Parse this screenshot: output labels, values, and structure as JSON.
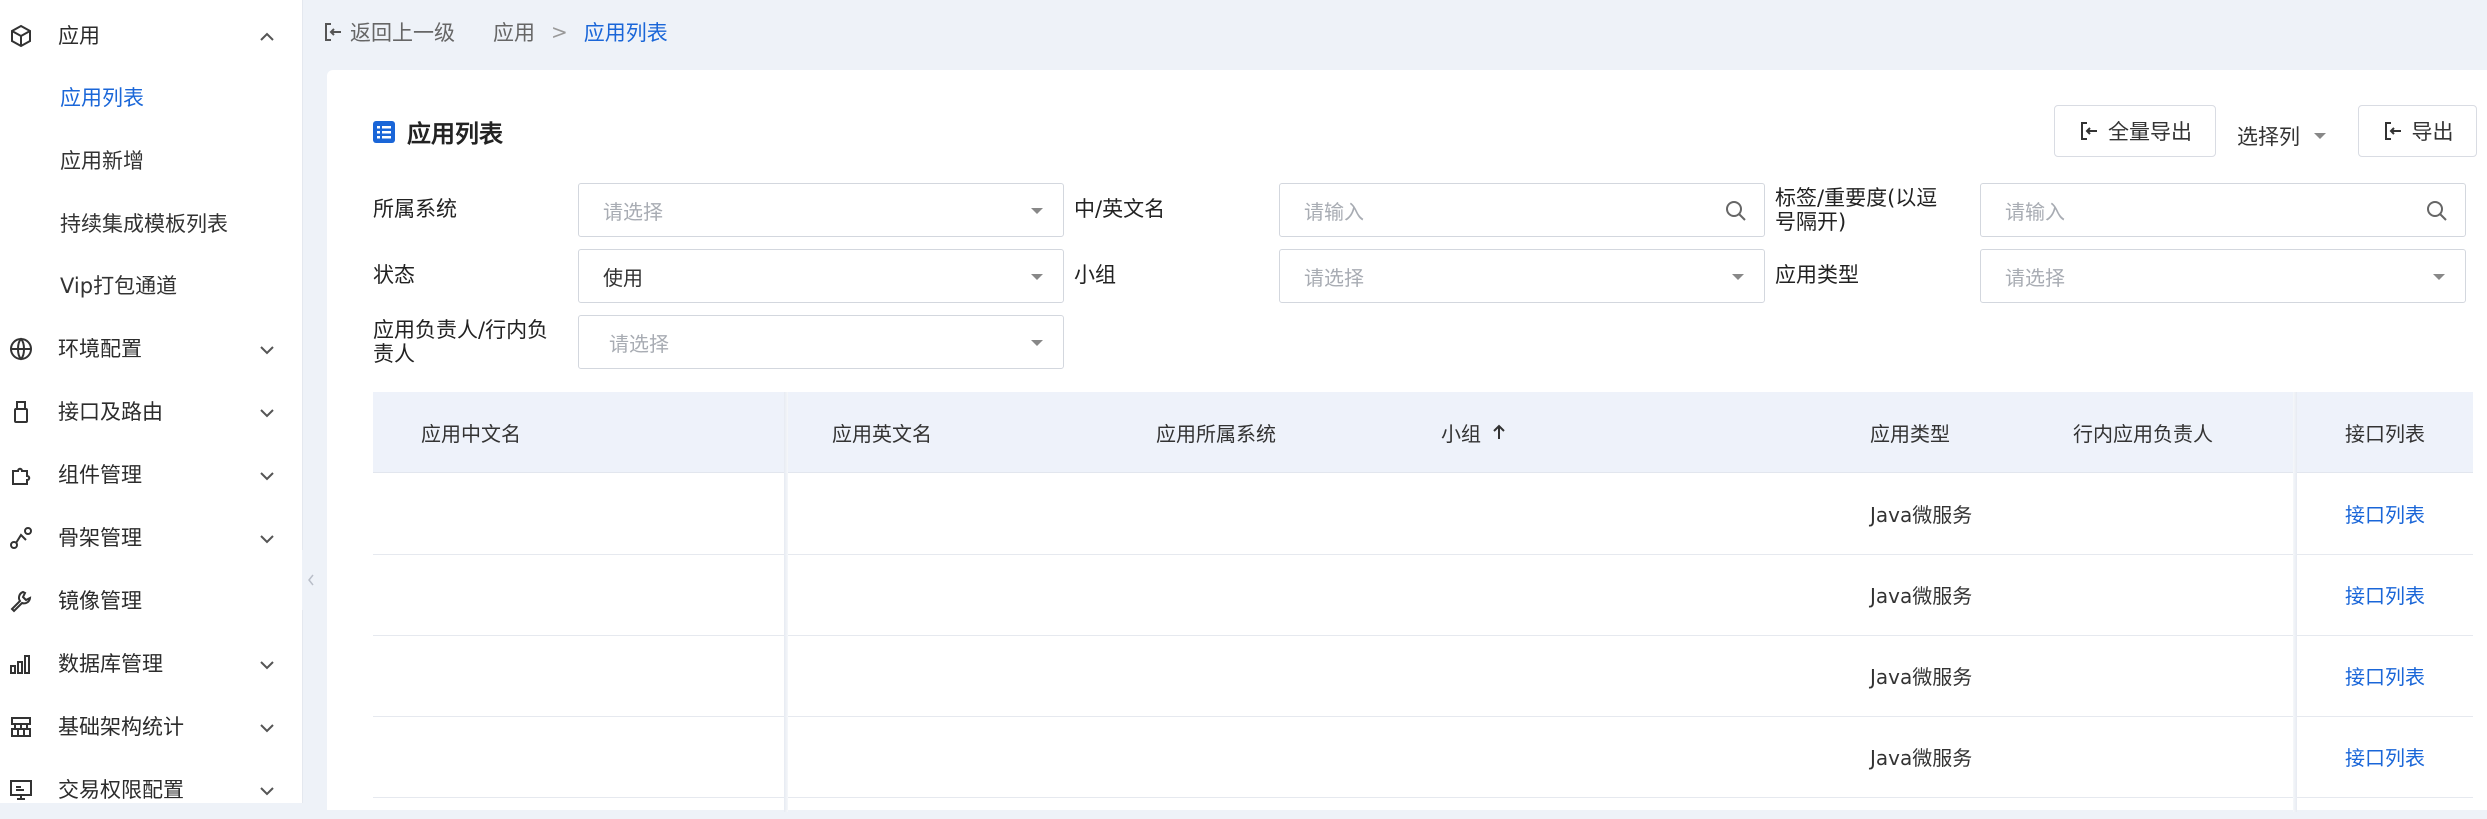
{
  "sidebar": {
    "top": {
      "label": "应用",
      "icon": "cube-icon"
    },
    "sub_items": [
      {
        "label": "应用列表",
        "active": true
      },
      {
        "label": "应用新增",
        "active": false
      },
      {
        "label": "持续集成模板列表",
        "active": false
      },
      {
        "label": "Vip打包通道",
        "active": false
      }
    ],
    "items": [
      {
        "label": "环境配置",
        "icon": "globe-icon"
      },
      {
        "label": "接口及路由",
        "icon": "usb-icon"
      },
      {
        "label": "组件管理",
        "icon": "puzzle-icon"
      },
      {
        "label": "骨架管理",
        "icon": "route-icon"
      },
      {
        "label": "镜像管理",
        "icon": "wrench-icon"
      },
      {
        "label": "数据库管理",
        "icon": "bar-chart-icon"
      },
      {
        "label": "基础架构统计",
        "icon": "org-chart-icon"
      },
      {
        "label": "交易权限配置",
        "icon": "monitor-icon"
      }
    ]
  },
  "breadcrumb": {
    "back_label": "返回上一级",
    "parent": "应用",
    "separator": ">",
    "current": "应用列表"
  },
  "page": {
    "title": "应用列表",
    "actions": {
      "export_all": "全量导出",
      "select_columns": "选择列",
      "export": "导出"
    }
  },
  "filters": {
    "system": {
      "label": "所属系统",
      "placeholder": "请选择"
    },
    "name": {
      "label": "中/英文名",
      "placeholder": "请输入"
    },
    "tags": {
      "label_line1": "标签/重要度(以逗",
      "label_line2": "号隔开)",
      "placeholder": "请输入"
    },
    "status": {
      "label": "状态",
      "value": "使用"
    },
    "group": {
      "label": "小组",
      "placeholder": "请选择"
    },
    "app_type": {
      "label": "应用类型",
      "placeholder": "请选择"
    },
    "owner": {
      "label_line1": "应用负责人/行内负",
      "label_line2": "责人",
      "placeholder": "请选择"
    }
  },
  "table": {
    "columns": {
      "cn_name": "应用中文名",
      "en_name": "应用英文名",
      "system": "应用所属系统",
      "group": "小组",
      "app_type": "应用类型",
      "owner": "行内应用负责人",
      "api_list": "接口列表"
    },
    "sort": {
      "column": "group",
      "direction": "asc"
    },
    "rows": [
      {
        "cn_name": "",
        "en_name": "",
        "system": "",
        "group": "",
        "app_type": "Java微服务",
        "owner": "",
        "api_list": "接口列表"
      },
      {
        "cn_name": "",
        "en_name": "",
        "system": "",
        "group": "",
        "app_type": "Java微服务",
        "owner": "",
        "api_list": "接口列表"
      },
      {
        "cn_name": "",
        "en_name": "",
        "system": "",
        "group": "",
        "app_type": "Java微服务",
        "owner": "",
        "api_list": "接口列表"
      },
      {
        "cn_name": "",
        "en_name": "",
        "system": "",
        "group": "",
        "app_type": "Java微服务",
        "owner": "",
        "api_list": "接口列表"
      }
    ]
  },
  "colors": {
    "accent": "#1a66d8",
    "background": "#eef2f8",
    "header_bg": "#eef2fa"
  }
}
